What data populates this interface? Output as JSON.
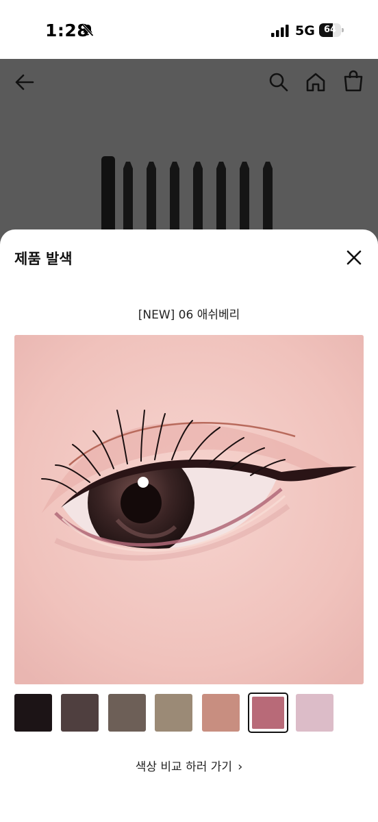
{
  "status_bar": {
    "time": "1:28",
    "network": "5G",
    "battery": "64",
    "battery_level": 0.64
  },
  "header": {
    "back_icon": "arrow-left-icon",
    "search_icon": "search-icon",
    "home_icon": "home-icon",
    "cart_icon": "shopping-bag-icon"
  },
  "sheet": {
    "title": "제품 발색",
    "close_icon": "close-icon",
    "shade_name": "[NEW] 06 애쉬베리",
    "swatches": [
      {
        "color": "#1c1416",
        "selected": false
      },
      {
        "color": "#4f3f3f",
        "selected": false
      },
      {
        "color": "#6d5f57",
        "selected": false
      },
      {
        "color": "#9b8a76",
        "selected": false
      },
      {
        "color": "#c88e80",
        "selected": false
      },
      {
        "color": "#b86a78",
        "selected": true
      },
      {
        "color": "#dcbcc8",
        "selected": false
      }
    ],
    "compare_label": "색상 비교 하러 가기",
    "compare_icon": "chevron-right-icon"
  },
  "colors": {
    "backdrop": "#5a5a5a",
    "skin": "#f2c7c2",
    "accent": "#111111"
  }
}
